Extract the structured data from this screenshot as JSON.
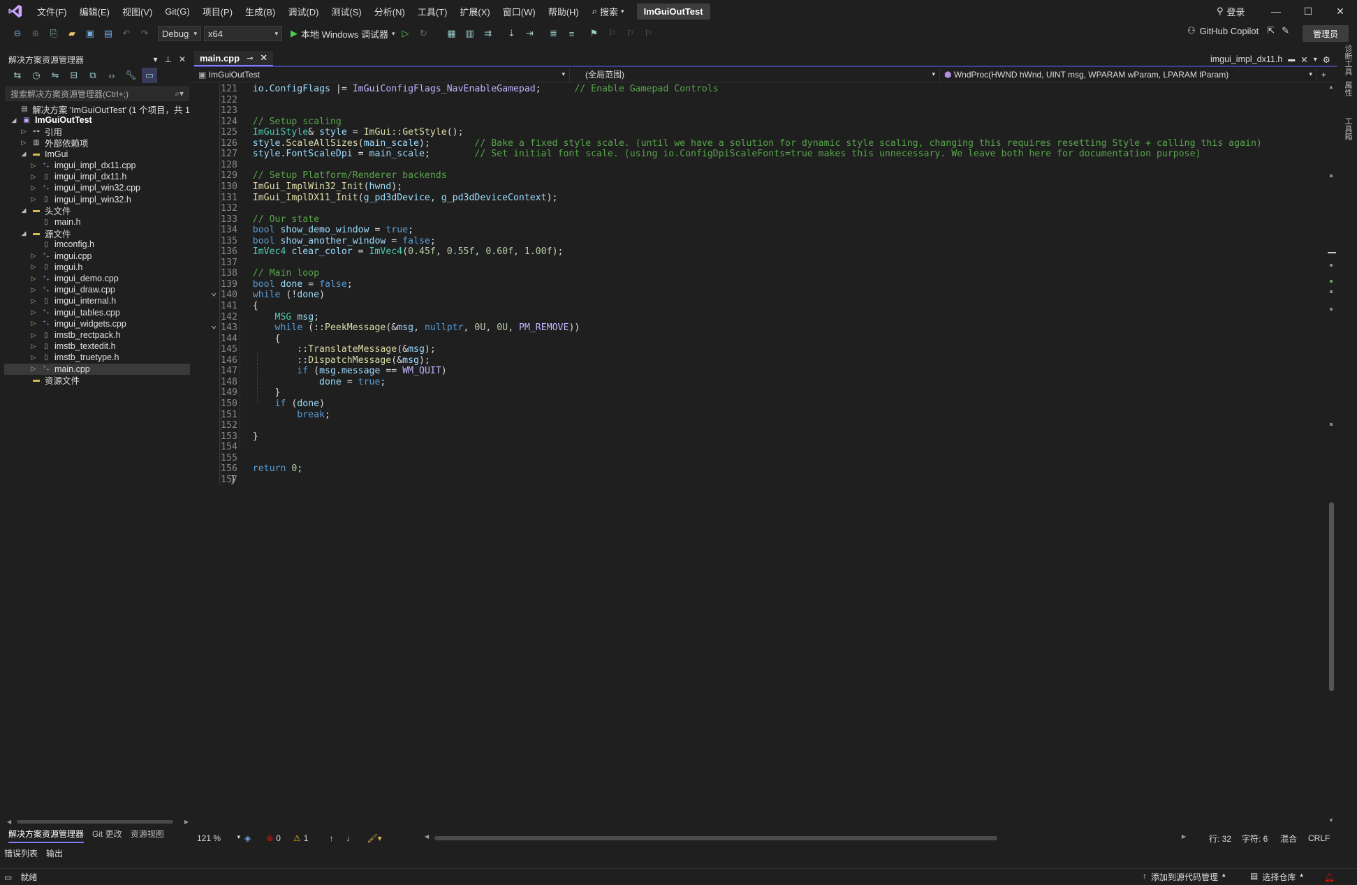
{
  "titlebar": {
    "menu": [
      "文件(F)",
      "编辑(E)",
      "视图(V)",
      "Git(G)",
      "项目(P)",
      "生成(B)",
      "调试(D)",
      "测试(S)",
      "分析(N)",
      "工具(T)",
      "扩展(X)",
      "窗口(W)",
      "帮助(H)"
    ],
    "search_label": "搜索",
    "solution_name": "ImGuiOutTest",
    "login_label": "登录"
  },
  "toolbar": {
    "config": "Debug",
    "platform": "x64",
    "run_label": "本地 Windows 调试器",
    "copilot_label": "GitHub Copilot",
    "admin_label": "管理员"
  },
  "solution_explorer": {
    "title": "解决方案资源管理器",
    "search_placeholder": "搜索解决方案资源管理器(Ctrl+;)",
    "tree": [
      {
        "label": "解决方案 'ImGuiOutTest' (1 个项目，共 1",
        "depth": 0,
        "twisty": "",
        "icon": "solution",
        "bold": false
      },
      {
        "label": "ImGuiOutTest",
        "depth": 0,
        "twisty": "open",
        "icon": "project",
        "bold": true
      },
      {
        "label": "引用",
        "depth": 1,
        "twisty": "closed",
        "icon": "references",
        "bold": false
      },
      {
        "label": "外部依赖项",
        "depth": 1,
        "twisty": "closed",
        "icon": "external",
        "bold": false
      },
      {
        "label": "ImGui",
        "depth": 1,
        "twisty": "open",
        "icon": "filter",
        "bold": false
      },
      {
        "label": "imgui_impl_dx11.cpp",
        "depth": 2,
        "twisty": "closed",
        "icon": "cpp",
        "bold": false
      },
      {
        "label": "imgui_impl_dx11.h",
        "depth": 2,
        "twisty": "closed",
        "icon": "h",
        "bold": false
      },
      {
        "label": "imgui_impl_win32.cpp",
        "depth": 2,
        "twisty": "closed",
        "icon": "cpp",
        "bold": false
      },
      {
        "label": "imgui_impl_win32.h",
        "depth": 2,
        "twisty": "closed",
        "icon": "h",
        "bold": false
      },
      {
        "label": "头文件",
        "depth": 1,
        "twisty": "open",
        "icon": "filter",
        "bold": false
      },
      {
        "label": "main.h",
        "depth": 2,
        "twisty": "",
        "icon": "h",
        "bold": false
      },
      {
        "label": "源文件",
        "depth": 1,
        "twisty": "open",
        "icon": "filter",
        "bold": false
      },
      {
        "label": "imconfig.h",
        "depth": 2,
        "twisty": "",
        "icon": "h",
        "bold": false
      },
      {
        "label": "imgui.cpp",
        "depth": 2,
        "twisty": "closed",
        "icon": "cpp",
        "bold": false
      },
      {
        "label": "imgui.h",
        "depth": 2,
        "twisty": "closed",
        "icon": "h",
        "bold": false
      },
      {
        "label": "imgui_demo.cpp",
        "depth": 2,
        "twisty": "closed",
        "icon": "cpp",
        "bold": false
      },
      {
        "label": "imgui_draw.cpp",
        "depth": 2,
        "twisty": "closed",
        "icon": "cpp",
        "bold": false
      },
      {
        "label": "imgui_internal.h",
        "depth": 2,
        "twisty": "closed",
        "icon": "h",
        "bold": false
      },
      {
        "label": "imgui_tables.cpp",
        "depth": 2,
        "twisty": "closed",
        "icon": "cpp",
        "bold": false
      },
      {
        "label": "imgui_widgets.cpp",
        "depth": 2,
        "twisty": "closed",
        "icon": "cpp",
        "bold": false
      },
      {
        "label": "imstb_rectpack.h",
        "depth": 2,
        "twisty": "closed",
        "icon": "h",
        "bold": false
      },
      {
        "label": "imstb_textedit.h",
        "depth": 2,
        "twisty": "closed",
        "icon": "h",
        "bold": false
      },
      {
        "label": "imstb_truetype.h",
        "depth": 2,
        "twisty": "closed",
        "icon": "h",
        "bold": false
      },
      {
        "label": "main.cpp",
        "depth": 2,
        "twisty": "closed",
        "icon": "cpp",
        "bold": false,
        "selected": true
      },
      {
        "label": "资源文件",
        "depth": 1,
        "twisty": "",
        "icon": "filter",
        "bold": false
      }
    ],
    "bottom_tabs": [
      "解决方案资源管理器",
      "Git 更改",
      "资源视图"
    ]
  },
  "bottom_panel_tabs": [
    "错误列表",
    "输出"
  ],
  "editor": {
    "active_tab": "main.cpp",
    "right_tab": "imgui_impl_dx11.h",
    "nav_project": "ImGuiOutTest",
    "nav_scope": "(全局范围)",
    "nav_member": "WndProc(HWND hWnd, UINT msg, WPARAM wParam, LPARAM lParam)",
    "lines": [
      {
        "n": "121",
        "code": "    io.ConfigFlags |= ImGuiConfigFlags_NavEnableGamepad;      // Enable Gamepad Controls"
      },
      {
        "n": "122",
        "code": ""
      },
      {
        "n": "123",
        "code": ""
      },
      {
        "n": "124",
        "code": "    // Setup scaling"
      },
      {
        "n": "125",
        "code": "    ImGuiStyle& style = ImGui::GetStyle();"
      },
      {
        "n": "126",
        "code": "    style.ScaleAllSizes(main_scale);        // Bake a fixed style scale. (until we have a solution for dynamic style scaling, changing this requires resetting Style + calling this again)"
      },
      {
        "n": "127",
        "code": "    style.FontScaleDpi = main_scale;        // Set initial font scale. (using io.ConfigDpiScaleFonts=true makes this unnecessary. We leave both here for documentation purpose)"
      },
      {
        "n": "128",
        "code": ""
      },
      {
        "n": "129",
        "code": "    // Setup Platform/Renderer backends"
      },
      {
        "n": "130",
        "code": "    ImGui_ImplWin32_Init(hwnd);"
      },
      {
        "n": "131",
        "code": "    ImGui_ImplDX11_Init(g_pd3dDevice, g_pd3dDeviceContext);"
      },
      {
        "n": "132",
        "code": ""
      },
      {
        "n": "133",
        "code": "    // Our state"
      },
      {
        "n": "134",
        "code": "    bool show_demo_window = true;"
      },
      {
        "n": "135",
        "code": "    bool show_another_window = false;"
      },
      {
        "n": "136",
        "code": "    ImVec4 clear_color = ImVec4(0.45f, 0.55f, 0.60f, 1.00f);"
      },
      {
        "n": "137",
        "code": ""
      },
      {
        "n": "138",
        "code": "    // Main loop"
      },
      {
        "n": "139",
        "code": "    bool done = false;"
      },
      {
        "n": "140",
        "code": "    while (!done)"
      },
      {
        "n": "141",
        "code": "    {"
      },
      {
        "n": "142",
        "code": "        MSG msg;"
      },
      {
        "n": "143",
        "code": "        while (::PeekMessage(&msg, nullptr, 0U, 0U, PM_REMOVE))"
      },
      {
        "n": "144",
        "code": "        {"
      },
      {
        "n": "145",
        "code": "            ::TranslateMessage(&msg);"
      },
      {
        "n": "146",
        "code": "            ::DispatchMessage(&msg);"
      },
      {
        "n": "147",
        "code": "            if (msg.message == WM_QUIT)"
      },
      {
        "n": "148",
        "code": "                done = true;"
      },
      {
        "n": "149",
        "code": "        }"
      },
      {
        "n": "150",
        "code": "        if (done)"
      },
      {
        "n": "151",
        "code": "            break;"
      },
      {
        "n": "152",
        "code": ""
      },
      {
        "n": "153",
        "code": "    }"
      },
      {
        "n": "154",
        "code": ""
      },
      {
        "n": "155",
        "code": ""
      },
      {
        "n": "156",
        "code": "    return 0;"
      },
      {
        "n": "157",
        "code": "}"
      }
    ],
    "zoom": "121 %",
    "errors": "0",
    "warnings": "1",
    "line_label": "行: 32",
    "char_label": "字符: 6",
    "whitespace": "混合",
    "eol": "CRLF"
  },
  "statusbar": {
    "ready": "就绪",
    "add_source": "添加到源代码管理",
    "select_repo": "选择仓库"
  },
  "right_dock": [
    "诊断工具",
    "属性",
    "工具箱"
  ],
  "colors": {
    "accent": "#7f7fff",
    "keyword": "#569cd6",
    "type": "#4ec9b0",
    "function": "#dcdcaa",
    "comment": "#57a64a",
    "number": "#b5cea8",
    "macro": "#beb7ff",
    "variable": "#9cdcfe"
  }
}
